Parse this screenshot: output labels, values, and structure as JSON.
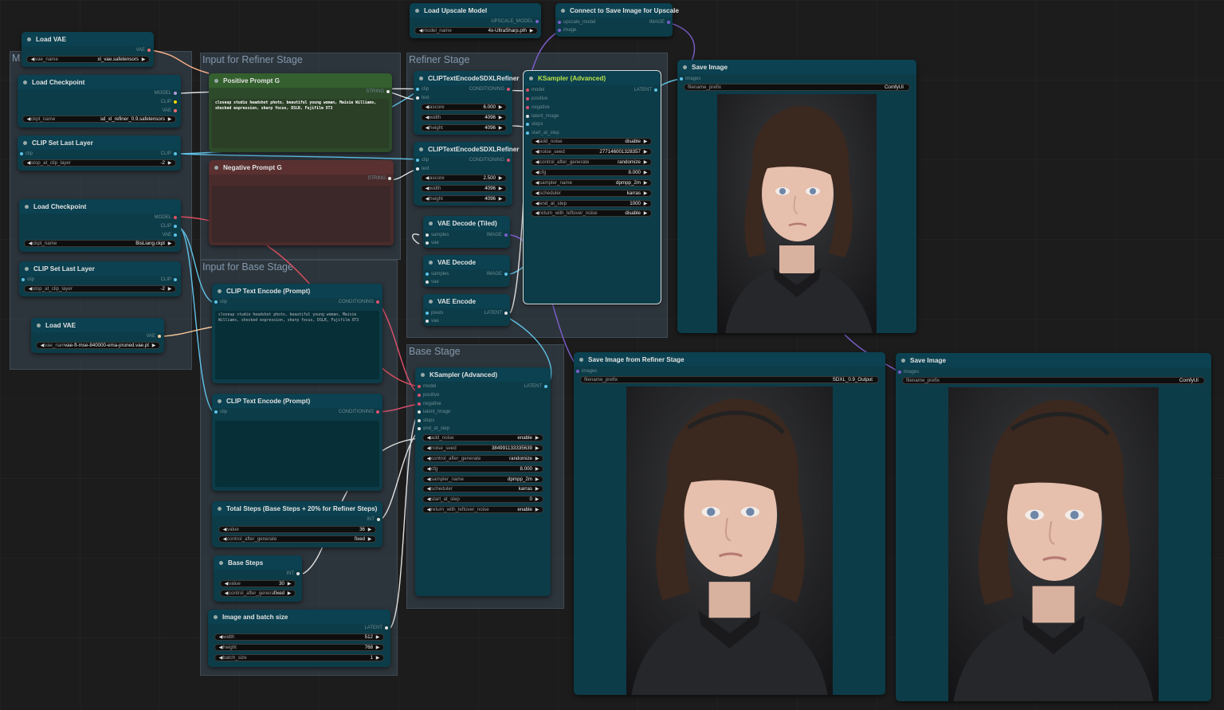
{
  "groups": {
    "m": "M",
    "refiner_input": "Input for Refiner Stage",
    "refiner_stage": "Refiner Stage",
    "base_input": "Input for Base Stage",
    "base_stage": "Base Stage"
  },
  "nodes": {
    "load_vae_1": {
      "title": "Load VAE",
      "out": "VAE",
      "w_label": "vae_name",
      "w_value": "xl_vae.safetensors"
    },
    "load_ckpt_1": {
      "title": "Load Checkpoint",
      "outs": [
        "MODEL",
        "CLIP",
        "VAE"
      ],
      "w_label": "ckpt_name",
      "w_value": "sd_xl_refiner_0.9.safetensors"
    },
    "clip_last_1": {
      "title": "CLIP Set Last Layer",
      "in": "clip",
      "out": "CLIP",
      "w_label": "stop_at_clip_layer",
      "w_value": "-2"
    },
    "load_ckpt_2": {
      "title": "Load Checkpoint",
      "outs": [
        "MODEL",
        "CLIP",
        "VAE"
      ],
      "w_label": "ckpt_name",
      "w_value": "BisLiang.ckpt"
    },
    "clip_last_2": {
      "title": "CLIP Set Last Layer",
      "in": "clip",
      "out": "CLIP",
      "w_label": "stop_at_clip_layer",
      "w_value": "-2"
    },
    "load_vae_2": {
      "title": "Load VAE",
      "out": "VAE",
      "w_label": "vae_name",
      "w_value": "vae-ft-mse-840000-ema-pruned.vae.pt"
    },
    "pos_prompt": {
      "title": "Positive Prompt G",
      "out": "STRING",
      "text": "closeup studio headshot photo, beautiful young woman, Maisie Williams, shocked expression, sharp focus, DSLR, Fujifilm XT3"
    },
    "neg_prompt": {
      "title": "Negative Prompt G",
      "out": "STRING",
      "text": ""
    },
    "clip_enc_1": {
      "title": "CLIP Text Encode (Prompt)",
      "in": "clip",
      "out": "CONDITIONING",
      "text": "closeup studio headshot photo, beautiful young woman, Maisie Williams, shocked expression, sharp focus, DSLR, Fujifilm XT3"
    },
    "clip_enc_2": {
      "title": "CLIP Text Encode (Prompt)",
      "in": "clip",
      "out": "CONDITIONING",
      "text": ""
    },
    "total_steps": {
      "title": "Total Steps (Base Steps + 20% for Refiner Steps)",
      "out": "INT",
      "w1_label": "value",
      "w1_value": "36",
      "w2_label": "control_after_generate",
      "w2_value": "fixed"
    },
    "base_steps": {
      "title": "Base Steps",
      "out": "INT",
      "w1_label": "value",
      "w1_value": "30",
      "w2_label": "control_after_generate",
      "w2_value": "fixed"
    },
    "img_batch": {
      "title": "Image and batch size",
      "out": "LATENT",
      "w1_label": "width",
      "w1_value": "512",
      "w2_label": "height",
      "w2_value": "768",
      "w3_label": "batch_size",
      "w3_value": "1"
    },
    "upscale_model": {
      "title": "Load Upscale Model",
      "out": "UPSCALE_MODEL",
      "w_label": "model_name",
      "w_value": "4x-UltraSharp.pth"
    },
    "connect_save": {
      "title": "Connect to Save Image for Upscale",
      "ins": [
        "upscale_model",
        "image"
      ],
      "out": "IMAGE"
    },
    "clip_refiner_1": {
      "title": "CLIPTextEncodeSDXLRefiner",
      "ins": [
        "clip",
        "text"
      ],
      "out": "CONDITIONING",
      "widgets": [
        [
          "ascore",
          "6.000"
        ],
        [
          "width",
          "4096"
        ],
        [
          "height",
          "4096"
        ]
      ]
    },
    "clip_refiner_2": {
      "title": "CLIPTextEncodeSDXLRefiner",
      "ins": [
        "clip",
        "text"
      ],
      "out": "CONDITIONING",
      "widgets": [
        [
          "ascore",
          "2.500"
        ],
        [
          "width",
          "4096"
        ],
        [
          "height",
          "4096"
        ]
      ]
    },
    "vae_decode_tiled": {
      "title": "VAE Decode (Tiled)",
      "ins": [
        "samples",
        "vae"
      ],
      "out": "IMAGE"
    },
    "vae_decode": {
      "title": "VAE Decode",
      "ins": [
        "samples",
        "vae"
      ],
      "out": "IMAGE"
    },
    "vae_encode": {
      "title": "VAE Encode",
      "ins": [
        "pixels",
        "vae"
      ],
      "out": "LATENT"
    },
    "ksampler_refiner": {
      "title": "KSampler (Advanced)",
      "ins": [
        "model",
        "positive",
        "negative",
        "latent_image",
        "steps",
        "start_at_step"
      ],
      "out": "LATENT",
      "widgets": [
        [
          "add_noise",
          "disable"
        ],
        [
          "noise_seed",
          "277146001328357"
        ],
        [
          "control_after_generate",
          "randomize"
        ],
        [
          "cfg",
          "8.000"
        ],
        [
          "sampler_name",
          "dpmpp_2m"
        ],
        [
          "scheduler",
          "karras"
        ],
        [
          "end_at_step",
          "1000"
        ],
        [
          "return_with_leftover_noise",
          "disable"
        ]
      ]
    },
    "ksampler_base": {
      "title": "KSampler (Advanced)",
      "ins": [
        "model",
        "positive",
        "negative",
        "latent_image",
        "steps",
        "end_at_step"
      ],
      "out": "LATENT",
      "widgets": [
        [
          "add_noise",
          "enable"
        ],
        [
          "noise_seed",
          "384991133335639"
        ],
        [
          "control_after_generate",
          "randomize"
        ],
        [
          "cfg",
          "8.000"
        ],
        [
          "sampler_name",
          "dpmpp_2m"
        ],
        [
          "scheduler",
          "karras"
        ],
        [
          "start_at_step",
          "0"
        ],
        [
          "return_with_leftover_noise",
          "enable"
        ]
      ]
    },
    "save_image_top": {
      "title": "Save Image",
      "in": "images",
      "w_label": "filename_prefix",
      "w_value": "ComfyUI"
    },
    "save_refiner": {
      "title": "Save Image from Refiner Stage",
      "in": "images",
      "w_label": "filename_prefix",
      "w_value": "SDXL_0.9_Output"
    },
    "save_image_right": {
      "title": "Save Image",
      "in": "images",
      "w_label": "filename_prefix",
      "w_value": "ComfyUI"
    }
  },
  "colors": {
    "canvas": "#1c1c1c",
    "node_body": "#0c3c48",
    "node_header": "#0b4150",
    "positive_node": "#2d4a2a",
    "negative_node": "#4a2b2b",
    "link_model": "#b39ddb",
    "link_clip": "#ffd500",
    "link_vae": "#ff6e6e",
    "link_conditioning": "#ffa931",
    "link_latent": "#ff9cf9",
    "link_image": "#64b5f6"
  }
}
